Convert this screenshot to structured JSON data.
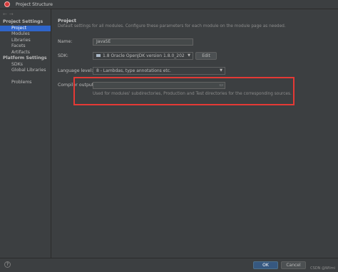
{
  "window": {
    "title": "Project Structure"
  },
  "nav": {
    "back": "←",
    "forward": "→"
  },
  "sidebar": {
    "project_settings_header": "Project Settings",
    "project_items": [
      "Project",
      "Modules",
      "Libraries",
      "Facets",
      "Artifacts"
    ],
    "platform_settings_header": "Platform Settings",
    "platform_items": [
      "SDKs",
      "Global Libraries"
    ],
    "problems": "Problems",
    "selected": "Project"
  },
  "main": {
    "heading": "Project",
    "description": "Default settings for all modules. Configure these parameters for each module on the module page as needed.",
    "name_label": "Name:",
    "name_value": "JavaSE",
    "sdk_label": "SDK:",
    "sdk_value": "1.8  Oracle OpenJDK version 1.8.0_202",
    "sdk_edit": "Edit",
    "language_level_label": "Language level:",
    "language_level_value": "8 - Lambdas, type annotations etc.",
    "compiler_output_label": "Compiler output:",
    "compiler_output_value": "",
    "compiler_output_hint": "Used for modules' subdirectories, Production and Test directories for the corresponding sources."
  },
  "footer": {
    "help": "?",
    "ok": "OK",
    "cancel": "Cancel",
    "watermark": "CSDN @Wlimi"
  },
  "colors": {
    "background": "#3c3f41",
    "selection": "#2f65ca",
    "highlight_box": "#e53935",
    "ok_button": "#365880"
  }
}
